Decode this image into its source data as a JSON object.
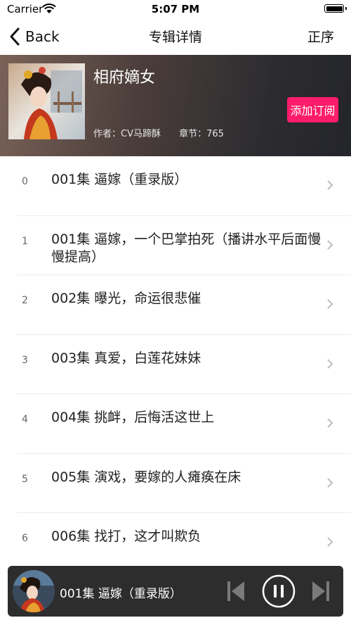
{
  "status_bar": {
    "carrier": "Carrier",
    "time": "5:07 PM"
  },
  "nav": {
    "back_label": "Back",
    "title": "专辑详情",
    "sort_label": "正序"
  },
  "album": {
    "title": "相府嫡女",
    "author": "作者：CV马蹄酥",
    "chapters": "章节：765",
    "subscribe_label": "添加订阅"
  },
  "episodes": [
    {
      "index": "0",
      "title": "001集 逼嫁（重录版）"
    },
    {
      "index": "1",
      "title": "001集 逼嫁，一个巴掌拍死（播讲水平后面慢慢提高）"
    },
    {
      "index": "2",
      "title": "002集 曝光，命运很悲催"
    },
    {
      "index": "3",
      "title": "003集 真爱，白莲花妹妹"
    },
    {
      "index": "4",
      "title": "004集 挑衅，后悔活这世上"
    },
    {
      "index": "5",
      "title": "005集 演戏，要嫁的人瘫痪在床"
    },
    {
      "index": "6",
      "title": "006集 找打，这才叫欺负"
    }
  ],
  "player": {
    "now_playing": "001集 逼嫁（重录版）"
  },
  "colors": {
    "accent": "#ff1c6a",
    "player_bg": "#2d2d2e"
  }
}
